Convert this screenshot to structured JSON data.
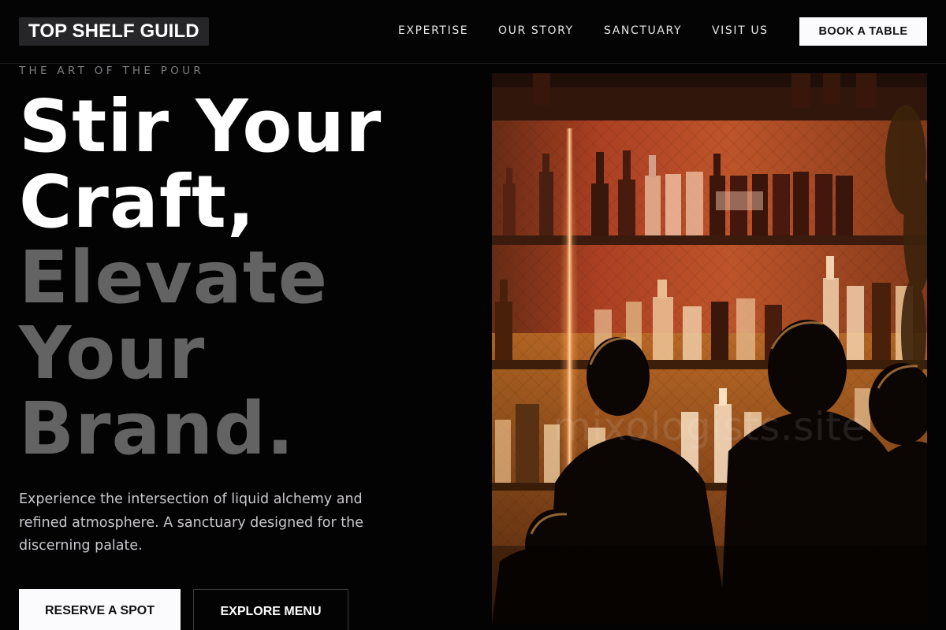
{
  "brand": {
    "name": "TOP SHELF GUILD"
  },
  "nav": {
    "items": [
      "EXPERTISE",
      "OUR STORY",
      "SANCTUARY",
      "VISIT US"
    ],
    "cta_label": "BOOK A TABLE"
  },
  "hero": {
    "eyebrow": "THE ART OF THE POUR",
    "headline_lines": [
      "Stir Your",
      "Craft,",
      "Elevate",
      "Your",
      "Brand."
    ],
    "description": "Experience the intersection of liquid alchemy and refined atmosphere. A sanctuary designed for the discerning palate.",
    "primary_button": "RESERVE A SPOT",
    "secondary_button": "EXPLORE MENU"
  },
  "photo": {
    "subject": "bar-shelves-with-patrons",
    "watermark": "mixologists.site"
  },
  "colors": {
    "background": "#040304",
    "headline_accent": "#646364",
    "button_light": "#fbfbfd"
  }
}
